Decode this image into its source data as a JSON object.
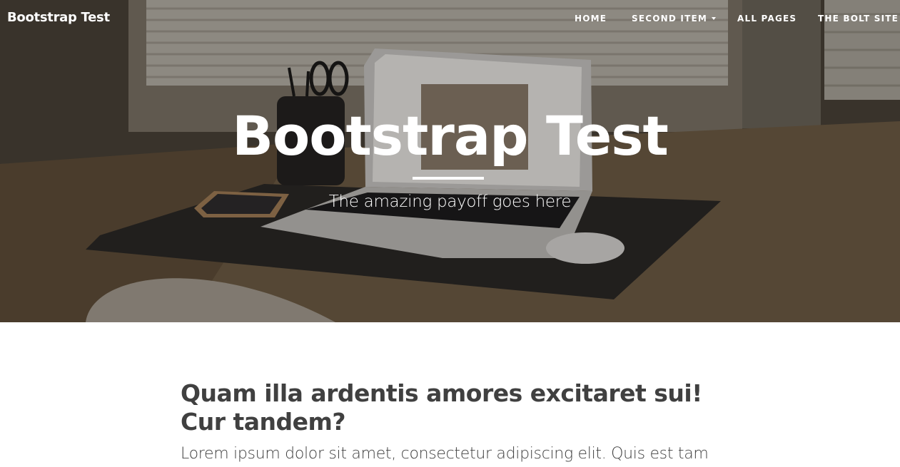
{
  "navbar": {
    "brand": "Bootstrap Test",
    "items": [
      {
        "label": "HOME"
      },
      {
        "label": "SECOND ITEM"
      },
      {
        "label": "ALL PAGES"
      },
      {
        "label": "THE BOLT SITE"
      }
    ]
  },
  "hero": {
    "title": "Bootstrap Test",
    "subtitle": "The amazing payoff goes here"
  },
  "post": {
    "title_line1": "Quam illa ardentis amores excitaret sui!",
    "title_line2": "Cur tandem?",
    "subtitle": "Lorem ipsum dolor sit amet, consectetur adipiscing elit. Quis est tam"
  },
  "colors": {
    "hero_overlay": "#000000",
    "heading_text": "#404040",
    "nav_text": "#ffffff"
  }
}
